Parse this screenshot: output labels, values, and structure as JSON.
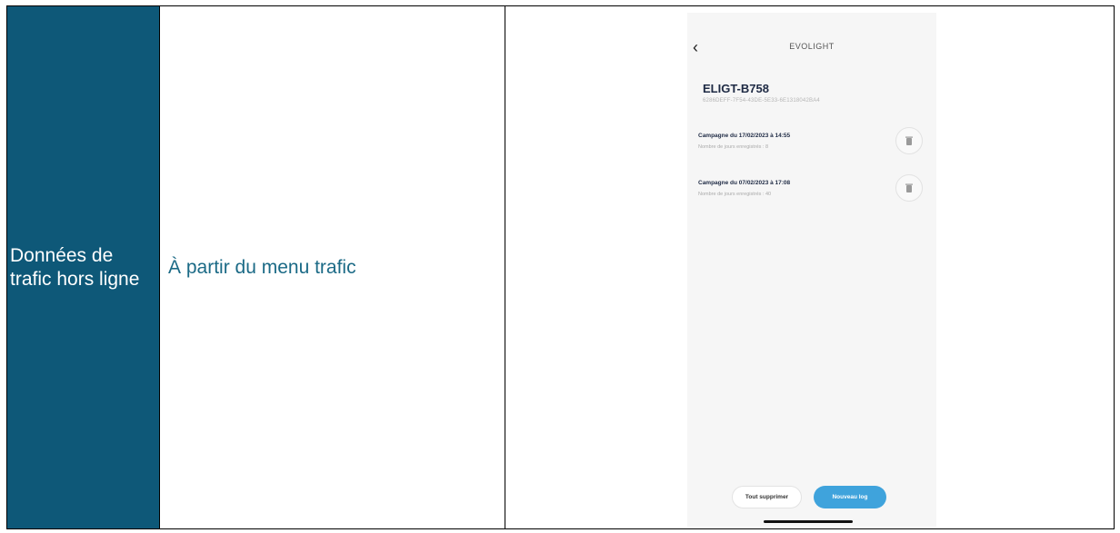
{
  "row": {
    "feature": "Données de trafic hors ligne",
    "description": "À partir du menu trafic"
  },
  "phone": {
    "back_icon": "chevron-left-icon",
    "app_title": "EVOLIGHT",
    "device_name": "ELIGT-B758",
    "device_uuid": "6286DEFF-7F54-43DE-5E33-6E1318042BA4",
    "campaigns": [
      {
        "title": "Campagne du 17/02/2023 à 14:55",
        "subtitle": "Nombre de jours enregistrés : 8"
      },
      {
        "title": "Campagne du 07/02/2023 à 17:08",
        "subtitle": "Nombre de jours enregistrés : 40"
      }
    ],
    "delete_all_label": "Tout supprimer",
    "new_log_label": "Nouveau log"
  },
  "colors": {
    "feature_bg": "#0e5878",
    "description_text": "#1b6a86",
    "primary_button": "#3fa3dc"
  }
}
